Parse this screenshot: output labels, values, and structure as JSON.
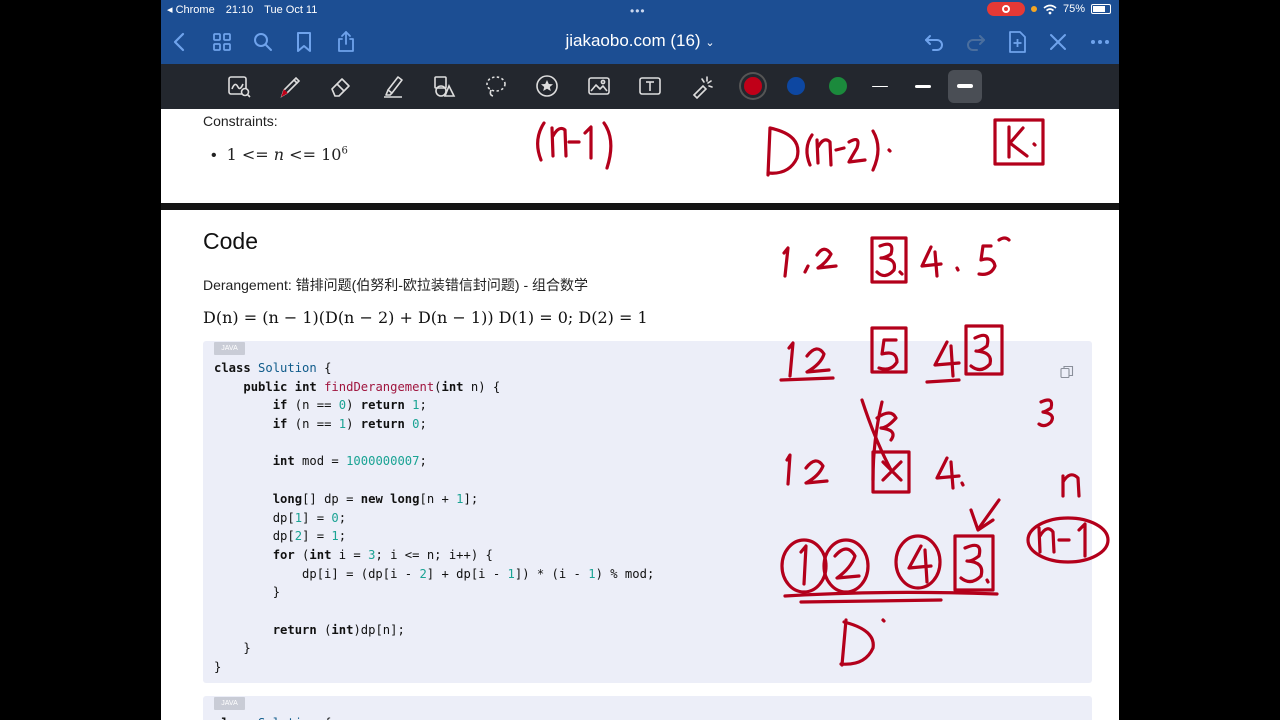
{
  "status_bar": {
    "app": "Chrome",
    "time": "21:10",
    "date": "Tue Oct 11",
    "battery": "75%",
    "battery_level": 0.75
  },
  "nav": {
    "title": "jiakaobo.com (16)",
    "icons": [
      "back-icon",
      "tabs-grid-icon",
      "search-icon",
      "bookmark-icon",
      "share-icon",
      "undo-icon",
      "redo-icon",
      "add-page-icon",
      "close-icon",
      "more-icon"
    ]
  },
  "toolbar": {
    "tools": [
      "lasso-text-icon",
      "pen-icon",
      "eraser-icon",
      "highlighter-icon",
      "shapes-icon",
      "lasso-icon",
      "sticker-icon",
      "image-icon",
      "text-box-icon",
      "laser-pointer-icon"
    ],
    "colors": [
      {
        "name": "red",
        "hex": "#c00018",
        "selected": true
      },
      {
        "name": "blue",
        "hex": "#0d47a1",
        "selected": false
      },
      {
        "name": "green",
        "hex": "#1b8a3c",
        "selected": false
      }
    ],
    "stroke_widths": [
      "thin",
      "medium",
      "thick"
    ],
    "selected_stroke": "thick"
  },
  "page1": {
    "constraints_label": "Constraints:",
    "constraint": {
      "lhs": "1 <= ",
      "var": "n",
      "rhs": " <= 10",
      "exp": "6"
    }
  },
  "page2": {
    "heading": "Code",
    "description": "Derangement: 错排问题(伯努利-欧拉装错信封问题) - 组合数学",
    "formula": "D(n) = (n − 1)(D(n − 2) + D(n − 1)) D(1) = 0; D(2) = 1",
    "code_blocks": [
      {
        "language": "JAVA",
        "lines": [
          "class Solution {",
          "    public int findDerangement(int n) {",
          "        if (n == 0) return 1;",
          "        if (n == 1) return 0;",
          "",
          "        int mod = 1000000007;",
          "",
          "        long[] dp = new long[n + 1];",
          "        dp[1] = 0;",
          "        dp[2] = 1;",
          "        for (int i = 3; i <= n; i++) {",
          "            dp[i] = (dp[i - 2] + dp[i - 1]) * (i - 1) % mod;",
          "        }",
          "",
          "        return (int)dp[n];",
          "    }",
          "}"
        ]
      },
      {
        "language": "JAVA",
        "lines": [
          "class Solution {"
        ]
      }
    ]
  }
}
